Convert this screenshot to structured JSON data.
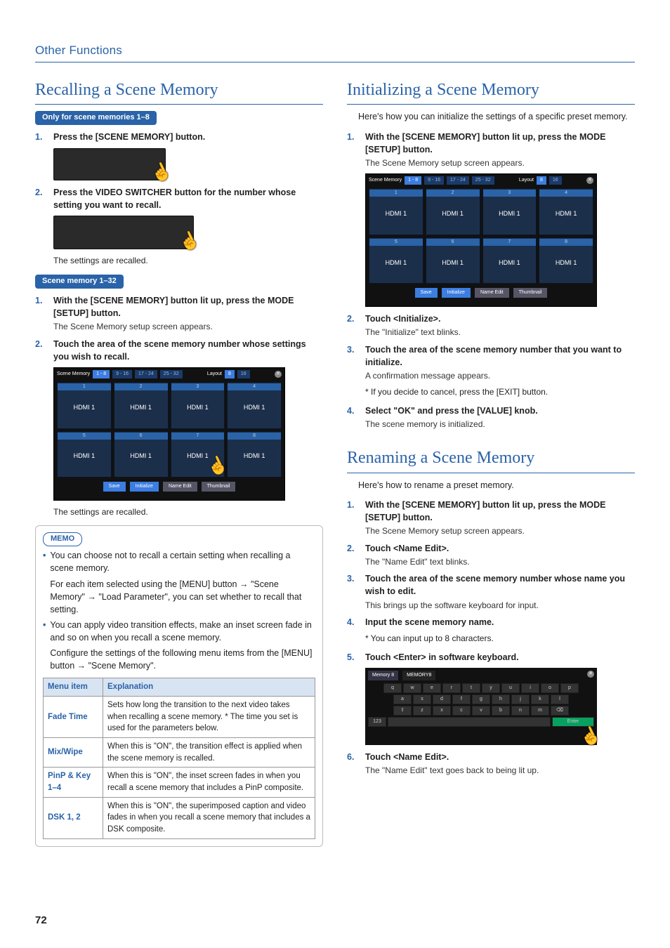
{
  "header": "Other Functions",
  "page_number": "72",
  "left": {
    "title": "Recalling a Scene Memory",
    "pill1": "Only for scene memories 1–8",
    "s1": "Press the [SCENE MEMORY] button.",
    "s2": "Press the VIDEO SWITCHER button for the number whose setting you want to recall.",
    "s2_sub": "The settings are recalled.",
    "pill2": "Scene memory 1–32",
    "s3": "With the [SCENE MEMORY] button lit up, press the MODE [SETUP] button.",
    "s3_sub": "The Scene Memory setup screen appears.",
    "s4": "Touch the area of the scene memory number whose settings you wish to recall.",
    "s4_sub": "The settings are recalled.",
    "memo_label": "MEMO",
    "memo_b1": "You can choose not to recall a certain setting when recalling a scene memory.",
    "memo_b1b": "For each item selected using the [MENU] button → \"Scene Memory\" → \"Load Parameter\", you can set whether to recall that setting.",
    "memo_b2": "You can apply video transition effects, make an inset screen fade in and so on when you recall a scene memory.",
    "memo_b2b": "Configure the settings of the following menu items from the [MENU] button → \"Scene Memory\".",
    "table": {
      "h1": "Menu item",
      "h2": "Explanation",
      "rows": [
        {
          "k": "Fade Time",
          "v": "Sets how long the transition to the next video takes when recalling a scene memory.\n* The time you set is used for the parameters below."
        },
        {
          "k": "Mix/Wipe",
          "v": "When this is \"ON\", the transition effect is applied when the scene memory is recalled."
        },
        {
          "k": "PinP & Key 1–4",
          "v": "When this is \"ON\", the inset screen fades in when you recall a scene memory that includes a PinP composite."
        },
        {
          "k": "DSK 1, 2",
          "v": "When this is \"ON\", the superimposed caption and video fades in when you recall a scene memory that includes a DSK composite."
        }
      ]
    }
  },
  "right_a": {
    "title": "Initializing a Scene Memory",
    "intro": "Here's how you can initialize the settings of a specific preset memory.",
    "s1": "With the [SCENE MEMORY] button lit up, press the MODE [SETUP] button.",
    "s1_sub": "The Scene Memory setup screen appears.",
    "s2": "Touch <Initialize>.",
    "s2_sub": "The \"Initialize\" text blinks.",
    "s3": "Touch the area of the scene memory number that you want to initialize.",
    "s3_sub": "A confirmation message appears.",
    "s3_note": "* If you decide to cancel, press the [EXIT] button.",
    "s4": "Select \"OK\" and press the [VALUE] knob.",
    "s4_sub": "The scene memory is initialized."
  },
  "right_b": {
    "title": "Renaming a Scene Memory",
    "intro": "Here's how to rename a preset memory.",
    "s1": "With the [SCENE MEMORY] button lit up, press the MODE [SETUP] button.",
    "s1_sub": "The Scene Memory setup screen appears.",
    "s2": "Touch <Name Edit>.",
    "s2_sub": "The \"Name Edit\" text blinks.",
    "s3": "Touch the area of the scene memory number whose name you wish to edit.",
    "s3_sub": "This brings up the software keyboard for input.",
    "s4": "Input the scene memory name.",
    "s4_note": "* You can input up to 8 characters.",
    "s5": "Touch <Enter> in software keyboard.",
    "s6": "Touch <Name Edit>.",
    "s6_sub": "The \"Name Edit\" text goes back to being lit up."
  },
  "screen": {
    "title": "Scene Memory",
    "tabs": [
      "1 - 8",
      "9 - 16",
      "17 - 24",
      "25 - 32"
    ],
    "layout_label": "Layout",
    "layout_vals": [
      "8",
      "16"
    ],
    "cells": [
      "1",
      "2",
      "3",
      "4",
      "5",
      "6",
      "7",
      "8"
    ],
    "cell_label": "HDMI 1",
    "btn_save": "Save",
    "btn_init": "Initialize",
    "btn_name": "Name Edit",
    "btn_thumb": "Thumbnail"
  },
  "kbd": {
    "bar_left": "Memory 8",
    "bar_field": "MEMORY8",
    "r1": [
      "q",
      "w",
      "e",
      "r",
      "t",
      "y",
      "u",
      "i",
      "o",
      "p"
    ],
    "r2": [
      "a",
      "s",
      "d",
      "f",
      "g",
      "h",
      "j",
      "k",
      "l"
    ],
    "r3": [
      "⇧",
      "z",
      "x",
      "c",
      "v",
      "b",
      "n",
      "m",
      "⌫"
    ],
    "r4_left": "123",
    "r4_right": "Enter"
  }
}
